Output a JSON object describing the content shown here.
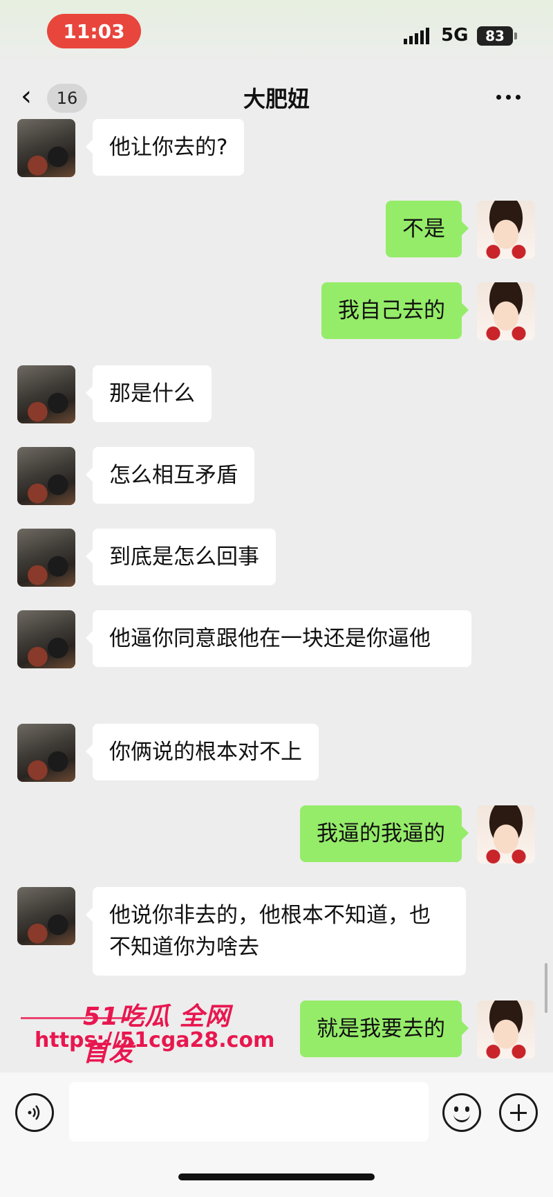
{
  "status_bar": {
    "time": "11:03",
    "network": "5G",
    "battery": "83"
  },
  "header": {
    "unread_count": "16",
    "title": "大肥妞"
  },
  "messages": [
    {
      "side": "left",
      "text": "他让你去的?"
    },
    {
      "side": "right",
      "text": "不是"
    },
    {
      "side": "right",
      "text": "我自己去的"
    },
    {
      "side": "left",
      "text": "那是什么"
    },
    {
      "side": "left",
      "text": "怎么相互矛盾"
    },
    {
      "side": "left",
      "text": "到底是怎么回事"
    },
    {
      "side": "left",
      "text": "他逼你同意跟他在一块还是你逼他"
    },
    {
      "side": "left",
      "text": "你俩说的根本对不上"
    },
    {
      "side": "right",
      "text": "我逼的我逼的"
    },
    {
      "side": "left",
      "text": "他说你非去的，他根本不知道，也不知道你为啥去"
    },
    {
      "side": "right",
      "text": "就是我要去的"
    }
  ],
  "watermark": {
    "title": "51吃瓜 全网首发",
    "url": "https://51cga28.com"
  },
  "input_bar": {
    "placeholder": ""
  },
  "colors": {
    "outgoing_bubble": "#95ec69",
    "incoming_bubble": "#ffffff",
    "background": "#ededed",
    "time_pill": "#e8453c",
    "watermark": "#e8174f"
  }
}
